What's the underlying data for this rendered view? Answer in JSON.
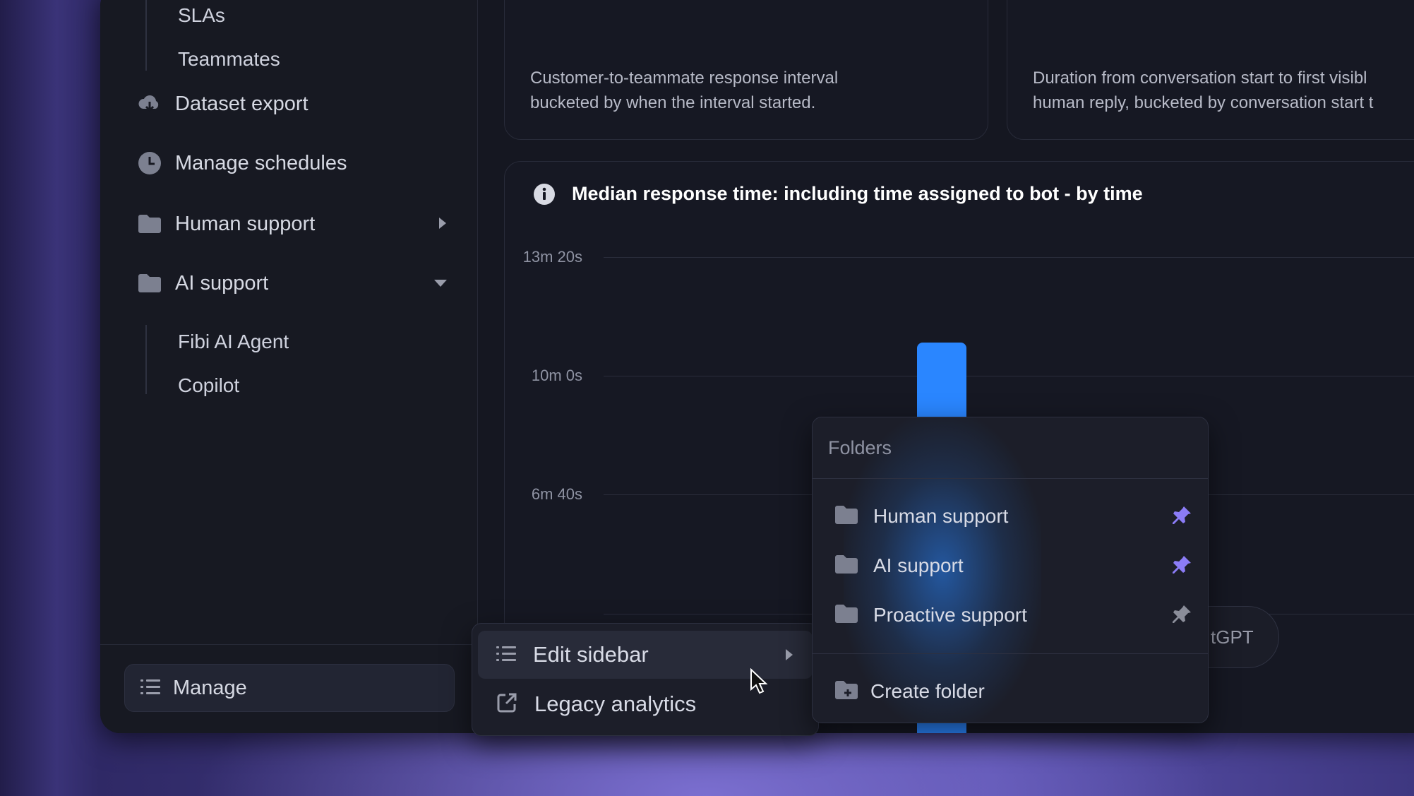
{
  "sidebar": {
    "sub_items_top": [
      "SLAs",
      "Teammates"
    ],
    "nav": {
      "dataset_export": "Dataset export",
      "manage_schedules": "Manage schedules",
      "human_support": "Human support",
      "ai_support": "AI support"
    },
    "ai_support_children": [
      "Fibi AI Agent",
      "Copilot"
    ],
    "manage_label": "Manage"
  },
  "cards": {
    "left_desc_line1": "Customer-to-teammate response interval",
    "left_desc_line2": "bucketed by when the interval started.",
    "right_desc_line1": "Duration from conversation start to first visibl",
    "right_desc_line2": "human reply, bucketed by conversation start t"
  },
  "chart_data": {
    "type": "bar",
    "title": "Median response time: including time assigned to bot - by time",
    "y_ticks": [
      "13m 20s",
      "10m 0s",
      "6m 40s"
    ],
    "ylabel": "",
    "xlabel": ""
  },
  "chatgpt_pill_text": "tGPT",
  "manage_menu": {
    "items": [
      {
        "label": "Edit sidebar",
        "icon": "list-icon",
        "has_submenu": true
      },
      {
        "label": "Legacy analytics",
        "icon": "external-link-icon",
        "has_submenu": false
      }
    ]
  },
  "folders_menu": {
    "header": "Folders",
    "folders": [
      {
        "label": "Human support",
        "pinned": true
      },
      {
        "label": "AI support",
        "pinned": true
      },
      {
        "label": "Proactive support",
        "pinned": false
      }
    ],
    "create_label": "Create folder"
  },
  "colors": {
    "accent_blue": "#2a86ff",
    "pin_active": "#8b7cf6",
    "pin_inactive": "#8a8d99"
  }
}
